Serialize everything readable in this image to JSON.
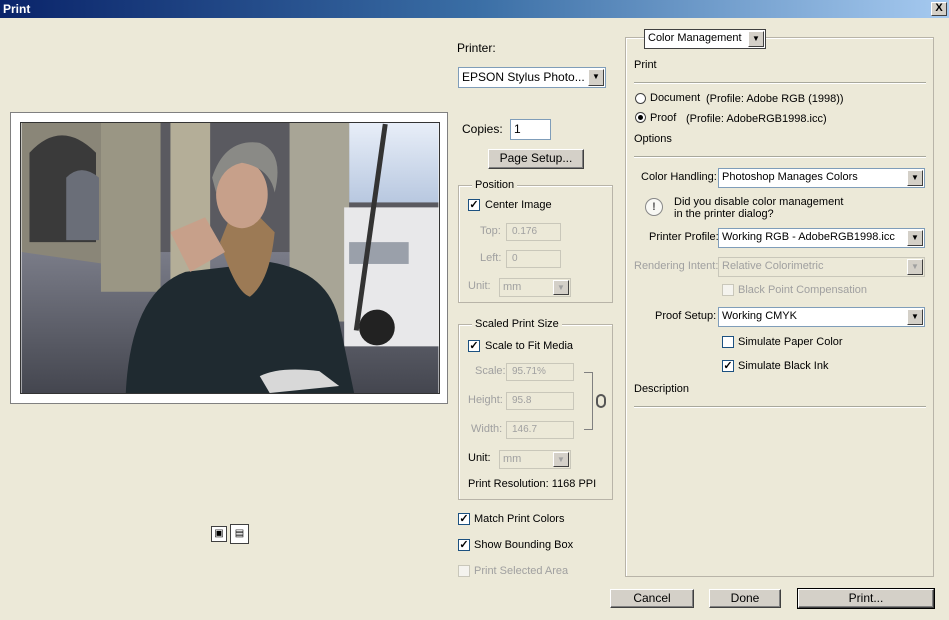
{
  "window": {
    "title": "Print",
    "close_glyph": "X"
  },
  "printer": {
    "label": "Printer:",
    "value": "EPSON Stylus Photo...",
    "copies_label": "Copies:",
    "copies_value": "1",
    "page_setup_label": "Page Setup..."
  },
  "position": {
    "legend": "Position",
    "center_image_label": "Center Image",
    "center_image_checked": true,
    "top_label": "Top:",
    "top_value": "0.176",
    "left_label": "Left:",
    "left_value": "0",
    "unit_label": "Unit:",
    "unit_value": "mm"
  },
  "scaled": {
    "legend": "Scaled Print Size",
    "fit_label": "Scale to Fit Media",
    "fit_checked": true,
    "scale_label": "Scale:",
    "scale_value": "95.71%",
    "height_label": "Height:",
    "height_value": "95.8",
    "width_label": "Width:",
    "width_value": "146.7",
    "unit_label": "Unit:",
    "unit_value": "mm",
    "resolution_text": "Print Resolution: 1168 PPI",
    "link_icon": "chain-link-icon"
  },
  "bottom_checks": {
    "match_colors": "Match Print Colors",
    "bounding_box": "Show Bounding Box",
    "selected_area": "Print Selected Area"
  },
  "preview": {
    "photo_description_icon": "photo-preview",
    "icons": [
      "page-orientation-icon",
      "preview-settings-icon"
    ]
  },
  "right_panel": {
    "dropdown_value": "Color Management",
    "print_heading": "Print",
    "document_label": "Document",
    "document_profile": "(Profile: Adobe RGB (1998))",
    "proof_label": "Proof",
    "proof_profile": "(Profile: AdobeRGB1998.icc)",
    "options_heading": "Options",
    "color_handling_label": "Color Handling:",
    "color_handling_value": "Photoshop Manages Colors",
    "warning_line1": "Did you disable color management",
    "warning_line2": "in the printer dialog?",
    "printer_profile_label": "Printer Profile:",
    "printer_profile_value": "Working RGB - AdobeRGB1998.icc",
    "rendering_intent_label": "Rendering Intent:",
    "rendering_intent_value": "Relative Colorimetric",
    "black_point_label": "Black Point Compensation",
    "proof_setup_label": "Proof Setup:",
    "proof_setup_value": "Working CMYK",
    "simulate_paper_label": "Simulate Paper Color",
    "simulate_black_label": "Simulate Black Ink",
    "description_heading": "Description"
  },
  "buttons": {
    "cancel": "Cancel",
    "done": "Done",
    "print": "Print..."
  }
}
